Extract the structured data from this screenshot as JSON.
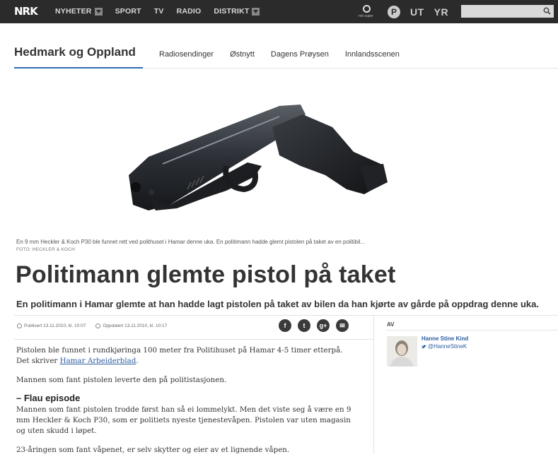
{
  "topbar": {
    "logo": "NRK",
    "nav": [
      {
        "label": "NYHETER",
        "dropdown": true
      },
      {
        "label": "SPORT",
        "dropdown": false
      },
      {
        "label": "TV",
        "dropdown": false
      },
      {
        "label": "RADIO",
        "dropdown": false
      },
      {
        "label": "DISTRIKT",
        "dropdown": true
      }
    ],
    "super_label": "nrk super",
    "p3_label": "P",
    "ut_label": "UT",
    "yr_label": "YR",
    "search_placeholder": ""
  },
  "section": {
    "title": "Hedmark og Oppland",
    "links": [
      "Radiosendinger",
      "Østnytt",
      "Dagens Prøysen",
      "Innlandsscenen"
    ]
  },
  "article": {
    "image_alt": "pistol-photo",
    "caption": "En 9 mm Heckler & Koch P30 ble funnet rett ved polithuset i Hamar denne uka. En politimann hadde glemt pistolen på taket av en politibil...",
    "credit": "FOTO: HECKLER & KOCH",
    "title": "Politimann glemte pistol på taket",
    "lead": "En politimann i Hamar glemte at han hadde lagt pistolen på taket av bilen da han kjørte av gårde på oppdrag denne uka.",
    "published": "Publisert 13.11.2010, kl. 10:07",
    "updated": "Oppdatert 13.11.2010, kl. 10:17",
    "share": [
      "f",
      "t",
      "g+",
      "✉"
    ],
    "p1_text": "Pistolen ble funnet i rundkjøringa 100 meter fra Politihuset på Hamar 4-5 timer etterpå. Det skriver ",
    "p1_link": "Hamar Arbeiderblad",
    "p1_end": ".",
    "p2": "Mannen som fant pistolen leverte den på politistasjonen.",
    "h2": "– Flau episode",
    "p3": "Mannen som fant pistolen trodde først han så ei lommelykt. Men det viste seg å være en 9 mm Heckler & Koch P30, som er politiets nyeste tjenestevåpen. Pistolen var uten magasin og uten skudd i løpet.",
    "p4": "23-åringen som fant våpenet, er selv skytter og eier av et lignende våpen."
  },
  "author": {
    "label": "AV",
    "name": "Hanne Stine Kind",
    "handle": "@HanneStineK"
  },
  "colors": {
    "topbar": "#2b2b2b",
    "accent": "#2d6bb5",
    "link": "#2d5ea0"
  }
}
